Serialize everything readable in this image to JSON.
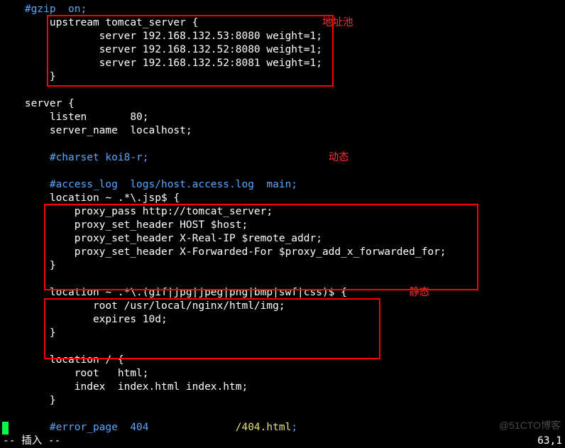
{
  "lines": {
    "l01": "    #gzip  on;",
    "l02": "        upstream tomcat_server {",
    "l03": "                server 192.168.132.53:8080 weight=1;",
    "l04": "                server 192.168.132.52:8080 weight=1;",
    "l05": "                server 192.168.132.52:8081 weight=1;",
    "l06": "        }",
    "blank": "",
    "l07": "    server {",
    "l08": "        listen       80;",
    "l09": "        server_name  localhost;",
    "l10": "        #charset koi8-r;",
    "l11": "        #access_log  logs/host.access.log  main;",
    "l12": "        location ~ .*\\.jsp$ {",
    "l13": "            proxy_pass http://tomcat_server;",
    "l14": "            proxy_set_header HOST $host;",
    "l15": "            proxy_set_header X-Real-IP $remote_addr;",
    "l16": "            proxy_set_header X-Forwarded-For $proxy_add_x_forwarded_for;",
    "l17": "        }",
    "l18": "        location ~ .*\\.(gif|jpg|jpeg|png|bmp|swf|css)$ {",
    "l19": "               root /usr/local/nginx/html/img;",
    "l20": "               expires 10d;",
    "l21": "        }",
    "l22": "        location / {",
    "l23": "            root   html;",
    "l24": "            index  index.html index.htm;",
    "l25": "        }",
    "l26a": "        #error_page  404",
    "l26b": "              /404.html",
    "l26c": ";"
  },
  "annotations": {
    "pool": "地址池",
    "dynamic": "动态",
    "static": "静态"
  },
  "statusbar": {
    "mode": "-- 插入 --",
    "pos": "63,1"
  },
  "watermark": "@51CTO博客"
}
